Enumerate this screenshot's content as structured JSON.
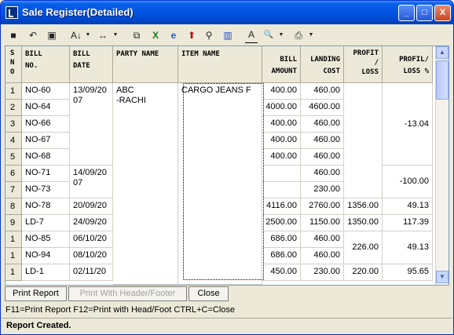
{
  "window": {
    "title": "Sale Register(Detailed)",
    "min_glyph": "_",
    "max_glyph": "□",
    "close_glyph": "X"
  },
  "toolbar": {
    "items": [
      {
        "name": "save-icon",
        "glyph": "■"
      },
      {
        "name": "undo-icon",
        "glyph": "↶"
      },
      {
        "name": "copy-window-icon",
        "glyph": "▣"
      },
      {
        "name": "sort-az-icon",
        "glyph": "A↓"
      },
      {
        "name": "column-width-icon",
        "glyph": "↔"
      },
      {
        "name": "copy-icon",
        "glyph": "⧉"
      },
      {
        "name": "excel-icon",
        "glyph": "X"
      },
      {
        "name": "internet-explorer-icon",
        "glyph": "e"
      },
      {
        "name": "up-arrow-icon",
        "glyph": "⬆"
      },
      {
        "name": "find-binoculars-icon",
        "glyph": "⚲"
      },
      {
        "name": "bar-chart-icon",
        "glyph": "▥"
      },
      {
        "name": "font-icon",
        "glyph": "A"
      },
      {
        "name": "print-preview-icon",
        "glyph": "🔍"
      },
      {
        "name": "printer-icon",
        "glyph": "⎙"
      }
    ]
  },
  "grid": {
    "headers": {
      "sno": "S\nN\nO",
      "bill_no": "BILL\nNO.",
      "bill_date": "BILL\nDATE",
      "party_name": "PARTY NAME",
      "item_name": "ITEM NAME",
      "bill_amount": "BILL\nAMOUNT",
      "landing_cost": "LANDING\nCOST",
      "profit_loss": "PROFIT\n/\nLOSS",
      "profit_loss_pct": "PROFIL/\nLOSS %"
    },
    "row_numbers": [
      "1",
      "2",
      "3",
      "4",
      "5",
      "6",
      "7",
      "8",
      "9",
      "1",
      "1",
      "1"
    ],
    "bill_no": [
      "NO-60",
      "NO-64",
      "NO-66",
      "NO-67",
      "NO-68",
      "NO-71",
      "NO-73",
      "NO-78",
      "LD-7",
      "NO-85",
      "NO-94",
      "LD-1"
    ],
    "bill_date_groups": [
      "13/09/20\n07",
      "14/09/20\n07",
      "20/09/20",
      "24/09/20",
      "06/10/20",
      "08/10/20",
      "02/11/20"
    ],
    "party_name": "ABC\n      -RACHI",
    "item_name": "CARGO JEANS F",
    "bill_amount": [
      "400.00",
      "4000.00",
      "400.00",
      "400.00",
      "400.00",
      "",
      "",
      "4116.00",
      "2500.00",
      "686.00",
      "686.00",
      "450.00"
    ],
    "landing_cost": [
      "460.00",
      "4600.00",
      "460.00",
      "460.00",
      "460.00",
      "460.00",
      "230.00",
      "2760.00",
      "1150.00",
      "460.00",
      "460.00",
      "230.00"
    ],
    "profit_loss": [
      "1356.00",
      "1350.00",
      "226.00",
      "220.00"
    ],
    "profit_loss_pct": [
      "-13.04",
      "-100.00",
      "49.13",
      "117.39",
      "49.13",
      "95.65"
    ]
  },
  "buttons": {
    "print_report": "Print Report",
    "print_with_header": "Print With Header/Footer",
    "close": "Close"
  },
  "hint": "F11=Print Report  F12=Print with Head/Foot  CTRL+C=Close",
  "status": "Report Created.",
  "scrollbar": {
    "up": "▲",
    "down": "▼"
  }
}
